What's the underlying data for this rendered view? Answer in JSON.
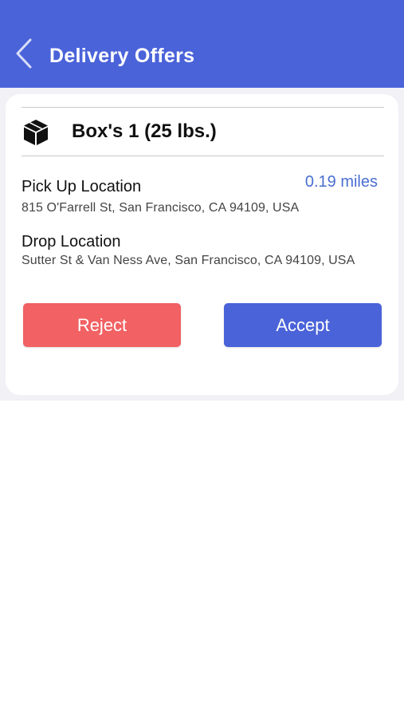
{
  "header": {
    "title": "Delivery Offers",
    "back_icon": "chevron-left-icon",
    "background": "#4a63d9"
  },
  "offer": {
    "package_icon": "box-icon",
    "package_title": "Box's 1 (25 lbs.)",
    "pickup_label": "Pick Up Location",
    "pickup_address": "815 O'Farrell St, San Francisco, CA 94109, USA",
    "distance": "0.19 miles",
    "drop_label": "Drop Location",
    "drop_address": "Sutter St & Van Ness Ave, San Francisco, CA 94109, USA"
  },
  "actions": {
    "reject_label": "Reject",
    "accept_label": "Accept",
    "reject_color": "#f26163",
    "accept_color": "#4a63d9"
  },
  "colors": {
    "distance": "#4a6fd1",
    "content_background": "#f1f1f6"
  }
}
